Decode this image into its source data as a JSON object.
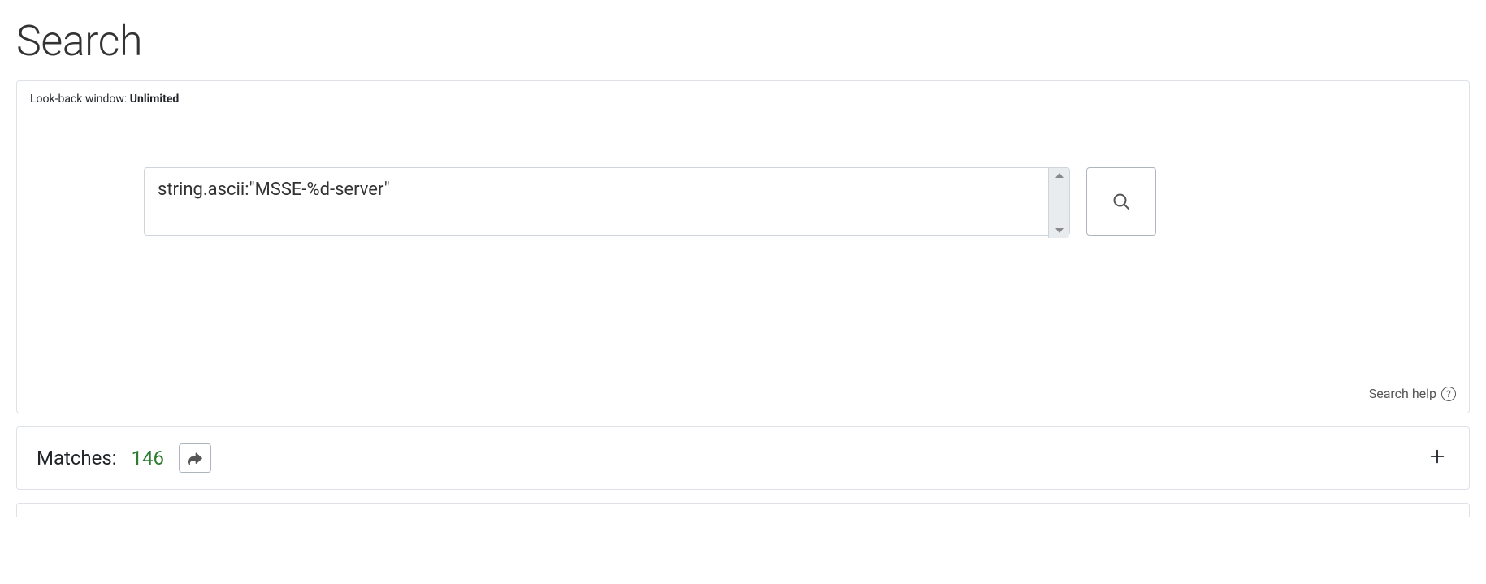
{
  "page": {
    "title": "Search"
  },
  "lookback": {
    "label": "Look-back window: ",
    "value": "Unlimited"
  },
  "search": {
    "query": "string.ascii:\"MSSE-%d-server\"",
    "help_label": "Search help"
  },
  "matches": {
    "label": "Matches:",
    "count": "146"
  },
  "icons": {
    "search": "search-icon",
    "help": "help-icon",
    "share": "share-icon",
    "plus": "plus-icon"
  }
}
